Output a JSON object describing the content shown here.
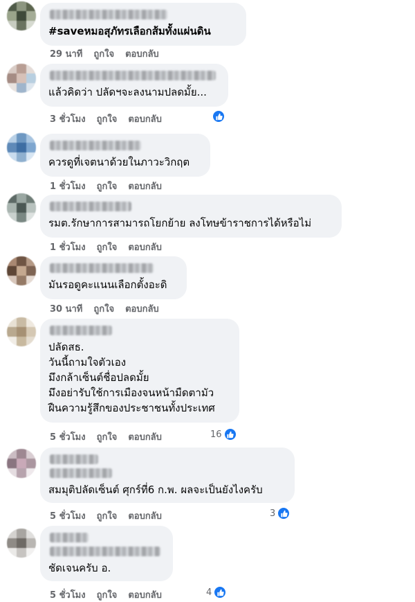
{
  "labels": {
    "like": "ถูกใจ",
    "reply": "ตอบกลับ"
  },
  "comments": [
    {
      "text": "#saveหมอสุภัทรเลือกส้มทั้งแผ่นดิน",
      "time": "29 นาที",
      "reactions": ""
    },
    {
      "text": "แล้วคิดว่า ปลัดฯจะลงนามปลดมั้ย...",
      "time": "3 ชั่วโมง",
      "reactions": ""
    },
    {
      "text": "ควรดูที่เจตนาด้วยในภาวะวิกฤต",
      "time": "1 ชั่วโมง",
      "reactions": ""
    },
    {
      "text": "รมต.รักษาการสามารถโยกย้าย ลงโทษข้าราชการได้หรือไม่",
      "time": "1 ชั่วโมง",
      "reactions": ""
    },
    {
      "text": "มันรอดูคะแนนเลือกตั้งอะดิ",
      "time": "30 นาที",
      "reactions": ""
    },
    {
      "text": "ปลัดสธ.\nวันนี้ถามใจตัวเอง\nมึงกล้าเซ็นต์ชื่อปลดมั้ย\nมึงอย่ารับใช้การเมืองจนหน้ามืดตามัว\nฝืนความรู้สึกของประชาชนทั้งประเทศ",
      "time": "5 ชั่วโมง",
      "reactions": "16"
    },
    {
      "text": "สมมุติปลัดเซ็นต์ ศุกร์ที่6 ก.พ. ผลจะเป็นยังไงครับ",
      "time": "5 ชั่วโมง",
      "reactions": "3"
    },
    {
      "text": "ชัดเจนครับ อ.",
      "time": "5 ชั่วโมง",
      "reactions": "4"
    }
  ]
}
